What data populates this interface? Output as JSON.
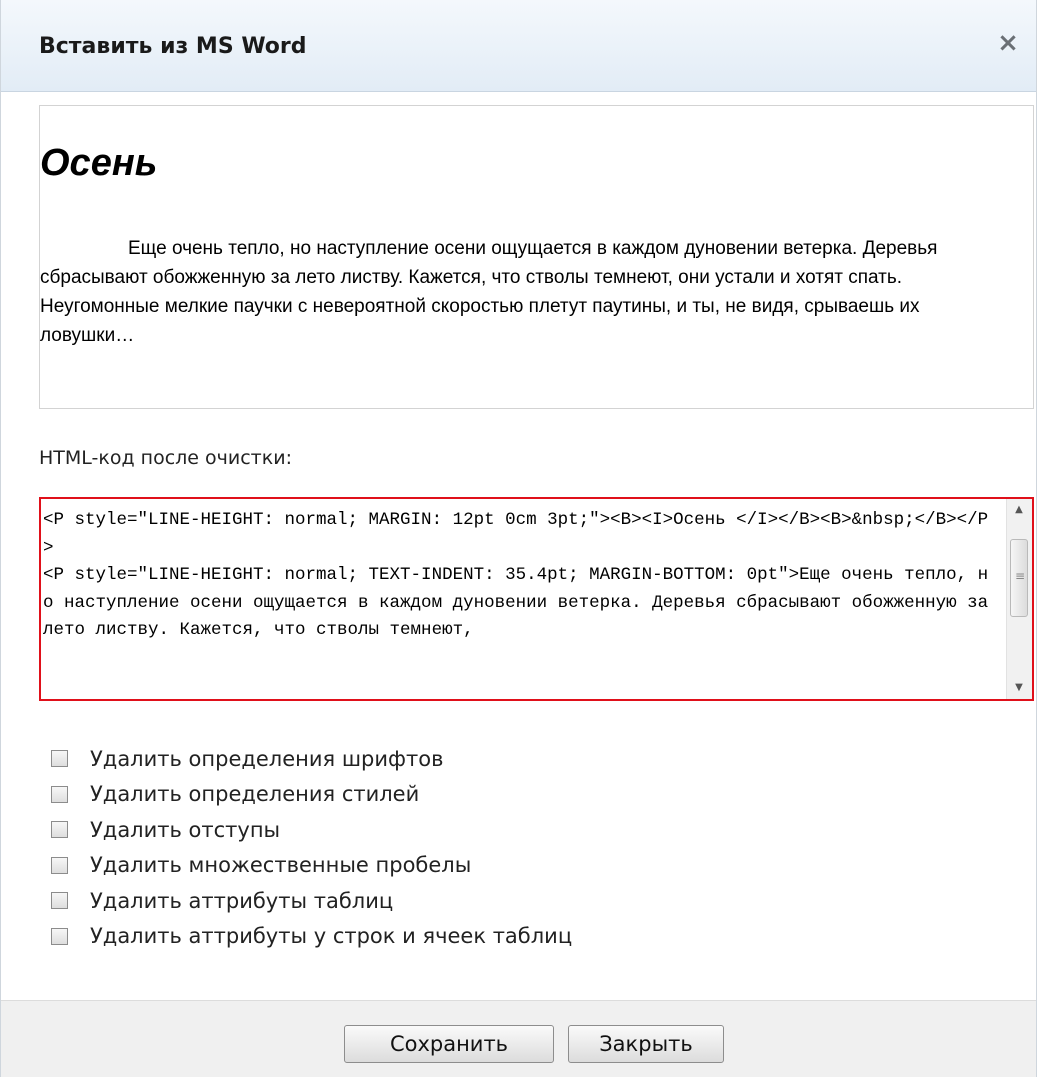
{
  "dialog": {
    "title": "Вставить из MS Word",
    "close_glyph": "×"
  },
  "preview": {
    "heading": "Осень",
    "paragraph": "Еще очень тепло, но наступление осени ощущается в каждом дуновении ветерка. Деревья сбрасывают обожженную за лето листву. Кажется, что стволы темнеют, они устали и хотят спать. Неугомонные мелкие паучки с невероятной скоростью плетут паутины, и ты, не видя, срываешь их ловушки…"
  },
  "code": {
    "label": "HTML-код после очистки:",
    "content": "<P style=\"LINE-HEIGHT: normal; MARGIN: 12pt 0cm 3pt;\"><B><I>Осень </I></B><B>&nbsp;</B></P>\n<P style=\"LINE-HEIGHT: normal; TEXT-INDENT: 35.4pt; MARGIN-BOTTOM: 0pt\">Еще очень тепло, но наступление осени ощущается в каждом дуновении ветерка. Деревья сбрасывают обожженную за лето листву. Кажется, что стволы темнеют,",
    "scroll_up_glyph": "▲",
    "scroll_down_glyph": "▼",
    "thumb_grip_glyph": "≡"
  },
  "options": [
    {
      "label": "Удалить определения шрифтов",
      "checked": false
    },
    {
      "label": "Удалить определения стилей",
      "checked": false
    },
    {
      "label": "Удалить отступы",
      "checked": false
    },
    {
      "label": "Удалить множественные пробелы",
      "checked": false
    },
    {
      "label": "Удалить аттрибуты таблиц",
      "checked": false
    },
    {
      "label": "Удалить аттрибуты у строк и ячеек таблиц",
      "checked": false
    }
  ],
  "footer": {
    "save_label": "Сохранить",
    "close_label": "Закрыть"
  },
  "colors": {
    "highlight_border": "#e0101a",
    "titlebar_bg": "#e2ecf6"
  }
}
